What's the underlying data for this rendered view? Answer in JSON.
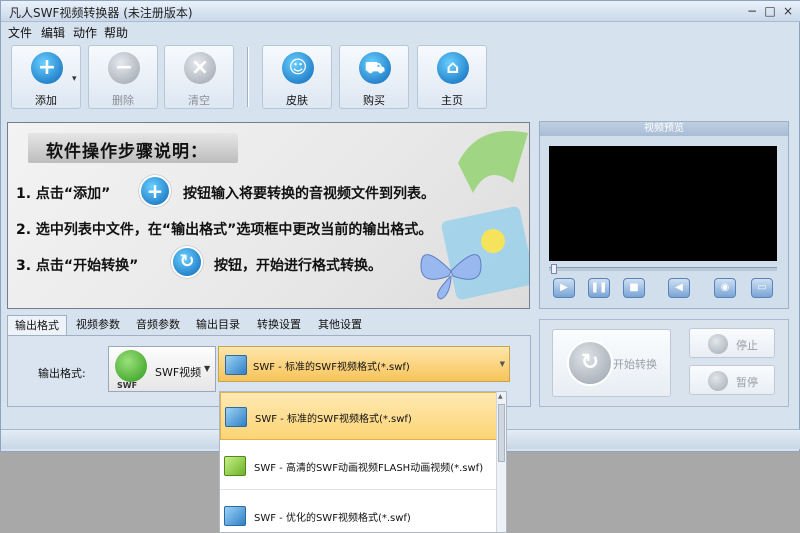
{
  "window": {
    "title": "凡人SWF视频转换器  (未注册版本)",
    "minimize": "−",
    "maximize": "□",
    "close": "×"
  },
  "menu": [
    "文件",
    "编辑",
    "动作",
    "帮助"
  ],
  "toolbar": {
    "add": "添加",
    "delete": "删除",
    "clear": "清空",
    "skin": "皮肤",
    "buy": "购买",
    "home": "主页",
    "add_arrow": "▾"
  },
  "guide": {
    "title": "软件操作步骤说明：",
    "step1_a": "1. 点击“添加”",
    "step1_b": "按钮输入将要转换的音视频文件到列表。",
    "step2": "2. 选中列表中文件，在“输出格式”选项框中更改当前的输出格式。",
    "step3_a": "3. 点击“开始转换”",
    "step3_b": "按钮，开始进行格式转换。"
  },
  "preview": {
    "title": "视频预览"
  },
  "tabs": [
    "输出格式",
    "视频参数",
    "音频参数",
    "输出目录",
    "转换设置",
    "其他设置"
  ],
  "output": {
    "label": "输出格式:",
    "format_value": "SWF视频",
    "format_logo": "SWF",
    "profile_selected": "SWF - 标准的SWF视频格式(*.swf)"
  },
  "actions": {
    "start": "开始转换",
    "stop": "停止",
    "pause": "暂停"
  },
  "dropdown": {
    "options": [
      {
        "label": "SWF - 标准的SWF视频格式(*.swf)",
        "icon": "blue-cube-icon"
      },
      {
        "label": "SWF - 高清的SWF动画视频FLASH动画视频(*.swf)",
        "icon": "green-cube-icon"
      },
      {
        "label": "SWF - 优化的SWF视频格式(*.swf)",
        "icon": "blue-cube-icon"
      }
    ]
  },
  "colors": {
    "accent": "#f7c45a",
    "frame": "#d7e2ef",
    "screen": "#000000"
  }
}
